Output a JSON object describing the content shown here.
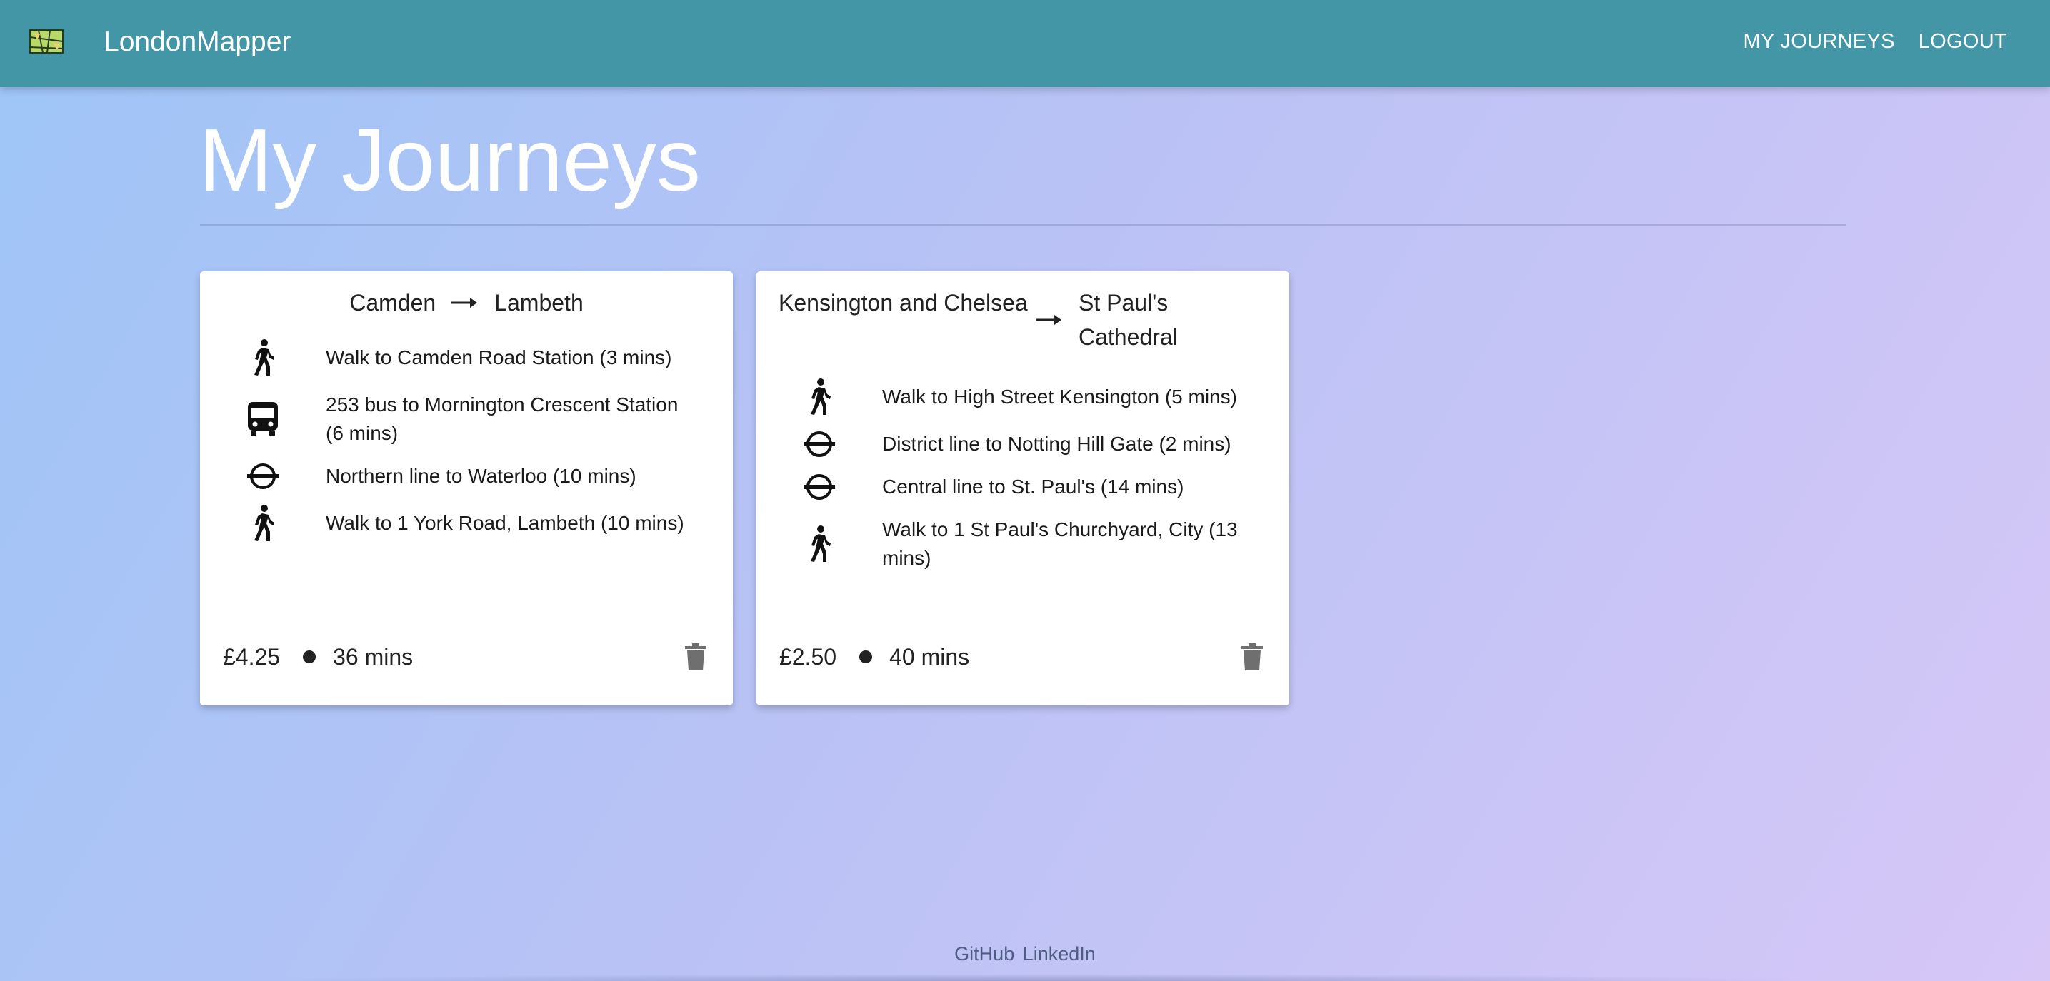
{
  "navbar": {
    "brand": "LondonMapper",
    "logo_icon": "map-icon",
    "links": [
      "MY JOURNEYS",
      "LOGOUT"
    ]
  },
  "page": {
    "title": "My Journeys"
  },
  "journeys": [
    {
      "from": "Camden",
      "to": "Lambeth",
      "steps": [
        {
          "icon": "walk-icon",
          "text": "Walk to Camden Road Station (3 mins)"
        },
        {
          "icon": "bus-icon",
          "text": "253 bus to Mornington Crescent Station (6 mins)"
        },
        {
          "icon": "tube-icon",
          "text": "Northern line to Waterloo (10 mins)"
        },
        {
          "icon": "walk-icon",
          "text": "Walk to 1 York Road, Lambeth (10 mins)"
        }
      ],
      "price": "£4.25",
      "duration": "36 mins"
    },
    {
      "from": "Kensington and Chelsea",
      "to": "St Paul's Cathedral",
      "steps": [
        {
          "icon": "walk-icon",
          "text": "Walk to High Street Kensington (5 mins)"
        },
        {
          "icon": "tube-icon",
          "text": "District line to Notting Hill Gate (2 mins)"
        },
        {
          "icon": "tube-icon",
          "text": "Central line to St. Paul's (14 mins)"
        },
        {
          "icon": "walk-icon",
          "text": "Walk to 1 St Paul's Churchyard, City (13 mins)"
        }
      ],
      "price": "£2.50",
      "duration": "40 mins"
    }
  ],
  "footer": {
    "links": [
      "GitHub",
      "LinkedIn"
    ]
  },
  "colors": {
    "navbar": "#4296a6",
    "card": "#ffffff",
    "text": "#222222",
    "delete_icon": "#6f6f6f"
  }
}
